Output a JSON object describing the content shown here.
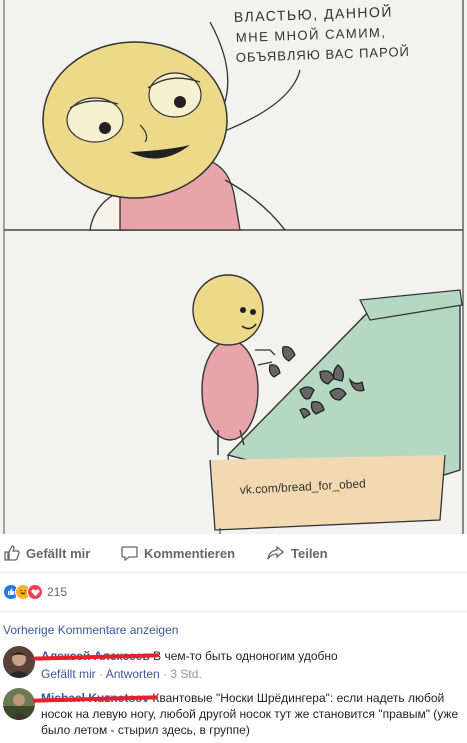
{
  "comic": {
    "speech": [
      "ВЛАСТЬЮ, ДАННОЙ",
      "МНЕ МНОЙ САМИМ,",
      "ОБЪЯВЛЯЮ ВАС ПАРОЙ"
    ],
    "watermark": "vk.com/bread_for_obed"
  },
  "actions": {
    "like": "Gefällt mir",
    "comment": "Kommentieren",
    "share": "Teilen"
  },
  "reactions": {
    "count": "215",
    "colors": [
      "#2078f4",
      "#f7b125",
      "#f33e58"
    ]
  },
  "previous_comments": "Vorherige Kommentare anzeigen",
  "comments": [
    {
      "author": "Алексей Алексеев",
      "text": "В чем-то быть одноногим удобно",
      "like": "Gefällt mir",
      "reply": "Antworten",
      "time": "3 Std."
    },
    {
      "author": "Michael Kuznetsov",
      "text": "Квантовые \"Носки Шрёдингера\": если надеть любой носок на левую ногу, любой другой носок тут же становится \"правым\" (уже было летом - стырил здесь, в группе)"
    }
  ]
}
